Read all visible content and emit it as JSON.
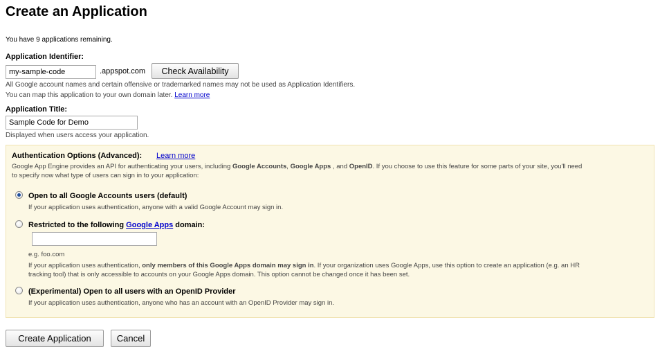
{
  "page": {
    "title": "Create an Application",
    "remaining_text": "You have 9 applications remaining."
  },
  "identifier": {
    "label": "Application Identifier:",
    "value": "my-sample-code",
    "suffix": ".appspot.com",
    "check_button": "Check Availability",
    "note1": "All Google account names and certain offensive or trademarked names may not be used as Application Identifiers.",
    "note2": "You can map this application to your own domain later.",
    "learn_more": "Learn more"
  },
  "title_field": {
    "label": "Application Title:",
    "value": "Sample Code for Demo",
    "note": "Displayed when users access your application."
  },
  "auth": {
    "heading": "Authentication Options (Advanced):",
    "learn_more": "Learn more",
    "intro_pre": "Google App Engine provides an API for authenticating your users, including ",
    "intro_b1": "Google Accounts",
    "intro_sep": ", ",
    "intro_b2": "Google Apps",
    "intro_mid": " , and ",
    "intro_b3": "OpenID",
    "intro_post": ". If you choose to use this feature for some parts of your site, you'll need",
    "intro_line2": "to specify now what type of users can sign in to your application:",
    "options": [
      {
        "label": "Open to all Google Accounts users (default)",
        "desc": "If your application uses authentication, anyone with a valid Google Account may sign in.",
        "selected": true
      },
      {
        "label_pre": "Restricted to the following ",
        "label_link": "Google Apps",
        "label_post": " domain:",
        "domain_value": "",
        "example": "e.g. foo.com",
        "desc_pre": "If your application uses authentication, ",
        "desc_bold": "only members of this Google Apps domain may sign in",
        "desc_post": ". If your organization uses Google Apps, use this option to create an application (e.g. an HR",
        "desc_line2": "tracking tool) that is only accessible to accounts on your Google Apps domain. This option cannot be changed once it has been set.",
        "selected": false
      },
      {
        "label": "(Experimental) Open to all users with an OpenID Provider",
        "desc": "If your application uses authentication, anyone who has an account with an OpenID Provider may sign in.",
        "selected": false
      }
    ]
  },
  "actions": {
    "create": "Create Application",
    "cancel": "Cancel"
  }
}
